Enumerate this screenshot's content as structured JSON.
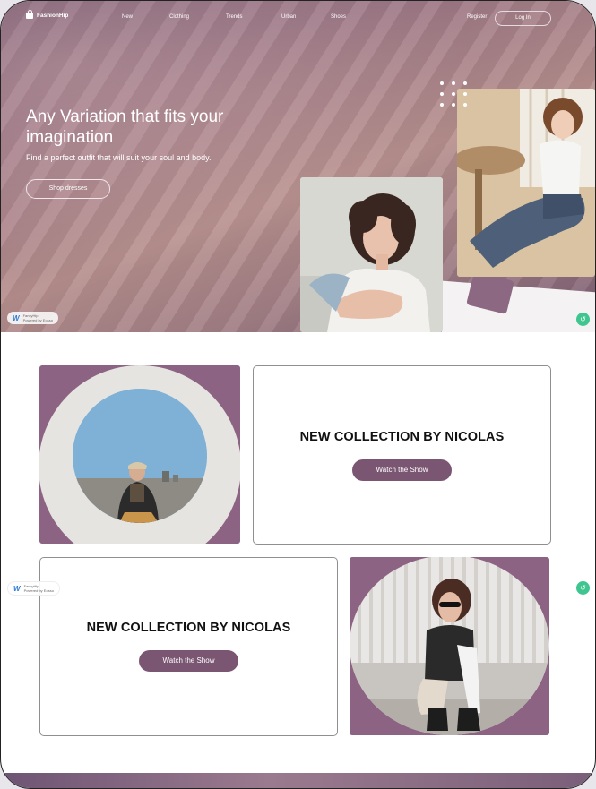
{
  "nav": {
    "brand": "FashionHip",
    "items": [
      {
        "label": "New",
        "active": true
      },
      {
        "label": "Clothing",
        "active": false
      },
      {
        "label": "Trends",
        "active": false
      },
      {
        "label": "Urban",
        "active": false
      },
      {
        "label": "Shoes",
        "active": false
      }
    ],
    "register": "Register",
    "login": "Log In"
  },
  "hero": {
    "headline": "Any Variation that fits your imagination",
    "subline": "Find a perfect outfit that will suit your soul and body.",
    "cta": "Shop dresses"
  },
  "badge": {
    "name": "FancyHip",
    "powered": "Powered by Eosso"
  },
  "collections": [
    {
      "title": "NEW COLLECTION BY NICOLAS",
      "button": "Watch the Show"
    },
    {
      "title": "NEW COLLECTION BY NICOLAS",
      "button": "Watch the Show"
    }
  ],
  "colors": {
    "accent": "#7b5673",
    "card_bg": "#8c6383",
    "share": "#3fc58f"
  },
  "icons": [
    "shopping-bag-icon",
    "share-icon",
    "dots-grid-icon",
    "brand-w-icon"
  ]
}
